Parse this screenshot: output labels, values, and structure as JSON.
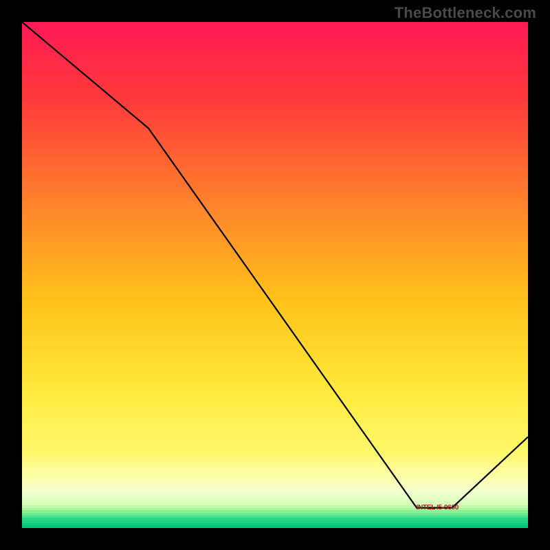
{
  "watermark": "TheBottleneck.com",
  "marker_label": "INTEL I5-9600",
  "chart_data": {
    "type": "line",
    "title": "",
    "xlabel": "",
    "ylabel": "",
    "xlim": [
      0,
      100
    ],
    "ylim": [
      0,
      100
    ],
    "x": [
      0,
      25,
      78,
      85,
      100
    ],
    "values": [
      100,
      79,
      4,
      4,
      18
    ],
    "gradient_stops": [
      {
        "pos": 0.0,
        "color": "#ff1a55"
      },
      {
        "pos": 0.15,
        "color": "#ff3a3a"
      },
      {
        "pos": 0.38,
        "color": "#ff8a2a"
      },
      {
        "pos": 0.55,
        "color": "#ffc21a"
      },
      {
        "pos": 0.72,
        "color": "#ffe83a"
      },
      {
        "pos": 0.85,
        "color": "#fff86a"
      },
      {
        "pos": 0.9,
        "color": "#fdffa8"
      },
      {
        "pos": 0.93,
        "color": "#f2ffce"
      },
      {
        "pos": 0.955,
        "color": "#d9feb9"
      },
      {
        "pos": 0.965,
        "color": "#a8f7a0"
      },
      {
        "pos": 0.975,
        "color": "#6be98f"
      },
      {
        "pos": 0.985,
        "color": "#29d884"
      },
      {
        "pos": 1.0,
        "color": "#00c878"
      }
    ],
    "marker": {
      "x_start": 77,
      "x_end": 87,
      "y": 4
    },
    "curve_color": "#000000",
    "curve_width": 2.2
  }
}
